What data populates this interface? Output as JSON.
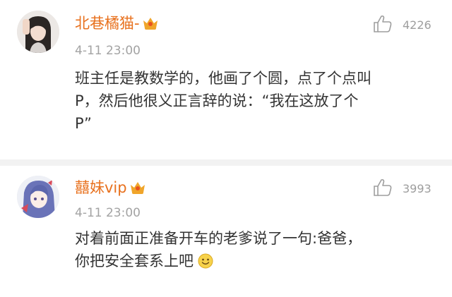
{
  "comments": [
    {
      "username": "北巷橘猫-",
      "time": "4-11 23:00",
      "likes": "4226",
      "body_lines": [
        "班主任是教数学的，他画了个圆，点了个点叫",
        "P，然后他很义正言辞的说：“我在这放了个",
        "P”"
      ],
      "badge_icon": "crown-icon",
      "like_icon": "thumbs-up-icon"
    },
    {
      "username": "囍妹vip",
      "time": "4-11 23:00",
      "likes": "3993",
      "body_lines": [
        "对着前面正准备开车的老爹说了一句:爸爸，",
        "你把安全套系上吧"
      ],
      "badge_icon": "crown-icon",
      "like_icon": "thumbs-up-icon",
      "inline_emoji": "smile-emoji"
    }
  ],
  "colors": {
    "username": "#e8711e",
    "body": "#333333",
    "meta": "#a3a3a3",
    "crown": "#f0a52a",
    "divider": "#f2f2f2"
  }
}
